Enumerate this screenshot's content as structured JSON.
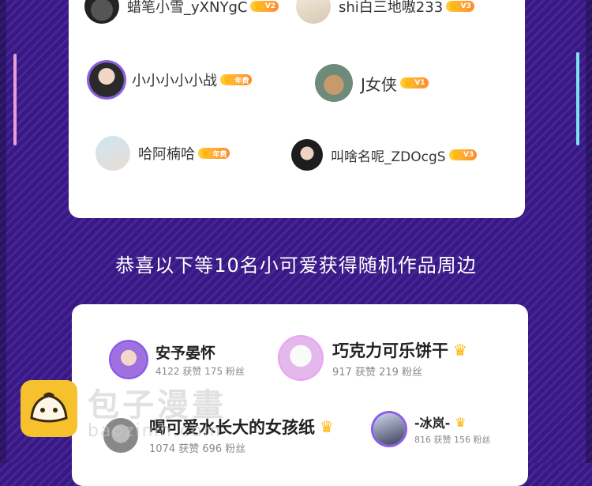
{
  "colors": {
    "background": "#3c1a8c",
    "card": "#ffffff",
    "crown": "#ffb300",
    "badge": "#ff8a2a",
    "banner_text": "#ffffff"
  },
  "top_list": [
    {
      "name": "蜡笔小雪_yXNYgC",
      "badge": "V2",
      "avatar": "cat-avatar"
    },
    {
      "name": "shi白三地嗷233",
      "badge": "V3",
      "avatar": "anime-avatar"
    },
    {
      "name": "小小小小小战",
      "badge": "年费",
      "avatar": "masked-girl-avatar"
    },
    {
      "name": "J女侠",
      "badge": "V1",
      "avatar": "cat-avatar"
    },
    {
      "name": "哈阿楠哈",
      "badge": "年费",
      "avatar": "anime-boy-avatar"
    },
    {
      "name": "叫啥名呢_ZDOcgS",
      "badge": "V3",
      "avatar": "girl-avatar"
    }
  ],
  "banner": {
    "text": "恭喜以下等10名小可爱获得随机作品周边"
  },
  "bottom_list": [
    {
      "name": "安予晏怀",
      "stats": "4122 获赞 175 粉丝",
      "avatar": "purple-frame-avatar"
    },
    {
      "name": "巧克力可乐饼干",
      "stats": "917 获赞 219 粉丝",
      "avatar": "sketch-avatar"
    },
    {
      "name": "喝可爱水长大的女孩纸",
      "stats": "1074 获赞 696 粉丝",
      "avatar": "grey-avatar"
    },
    {
      "name": "-冰岚-",
      "stats": "816 获赞 156 粉丝",
      "avatar": "anime-boy-avatar"
    }
  ],
  "watermark": {
    "brand": "包子漫畫",
    "url": "baozimh.com"
  }
}
